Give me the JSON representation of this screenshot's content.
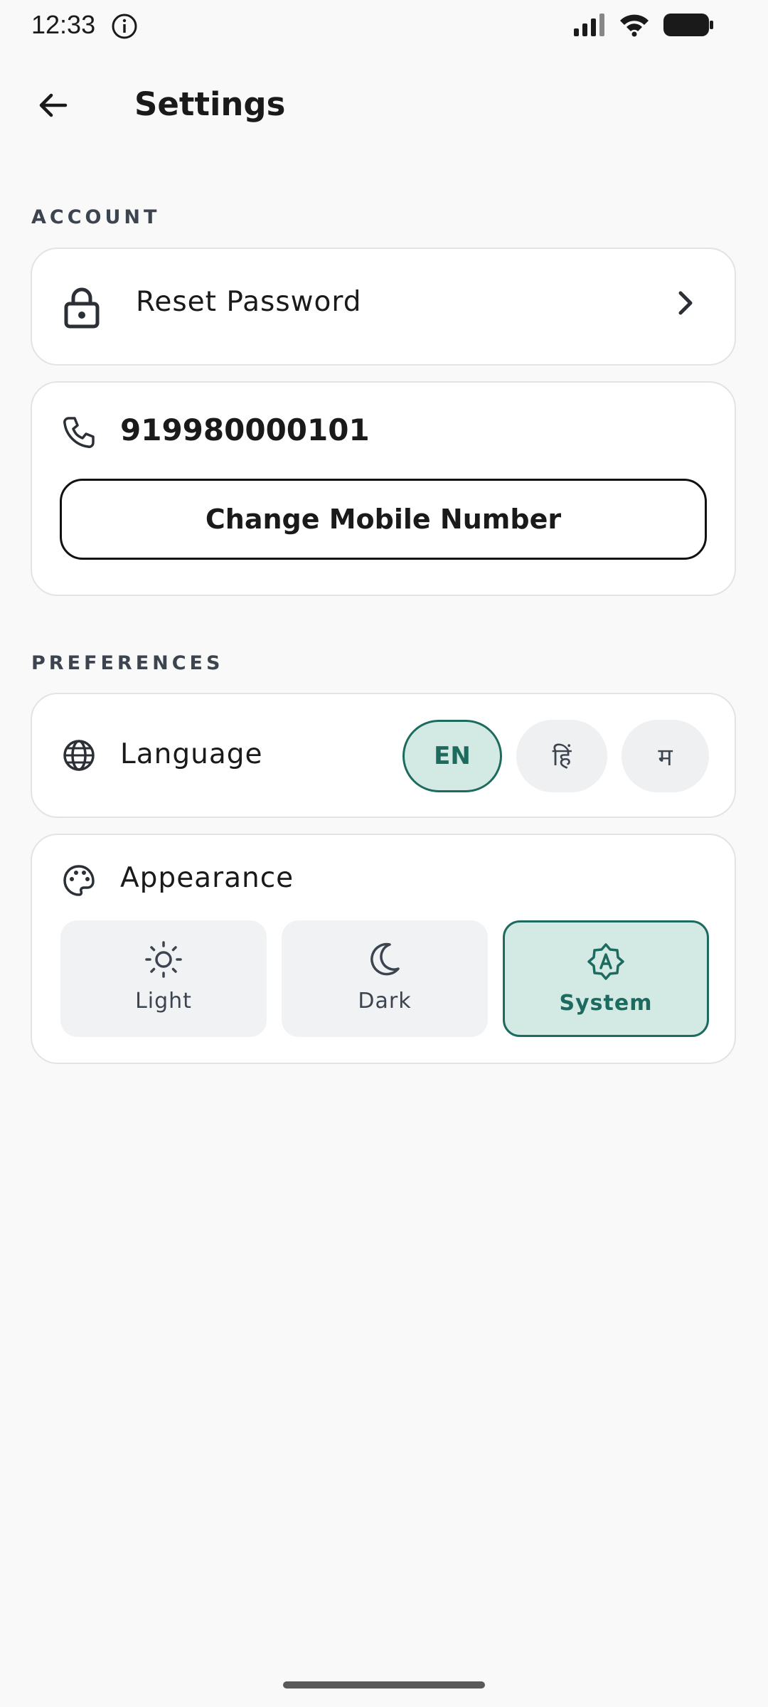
{
  "status_bar": {
    "time": "12:33"
  },
  "app_bar": {
    "title": "Settings"
  },
  "account": {
    "section_label": "ACCOUNT",
    "reset_password_label": "Reset Password",
    "phone_number": "919980000101",
    "change_mobile_label": "Change Mobile Number"
  },
  "preferences": {
    "section_label": "PREFERENCES",
    "language": {
      "label": "Language",
      "options": [
        "EN",
        "हिं",
        "म"
      ],
      "selected": "EN"
    },
    "appearance": {
      "label": "Appearance",
      "options": [
        "Light",
        "Dark",
        "System"
      ],
      "selected": "System"
    }
  },
  "colors": {
    "accent": "#1c6b5e",
    "accent_bg": "#d3e9e4",
    "background": "#f9f9f9",
    "card": "#ffffff"
  },
  "icons": {
    "back": "arrow-left-icon",
    "reset_password": "lock-icon",
    "reset_chevron": "chevron-right-icon",
    "phone": "phone-icon",
    "language": "globe-icon",
    "appearance": "palette-icon",
    "light": "sun-icon",
    "dark": "moon-icon",
    "system": "auto-brightness-icon"
  }
}
